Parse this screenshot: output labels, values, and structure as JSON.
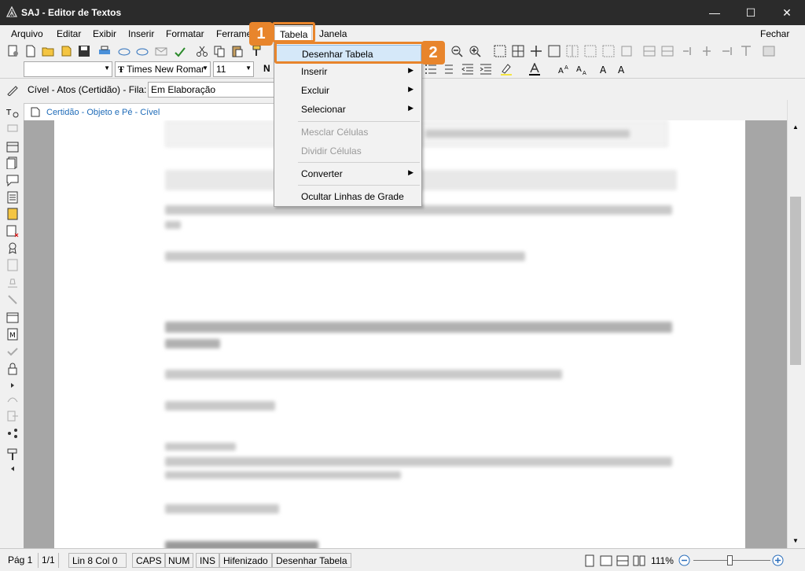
{
  "window": {
    "title": "SAJ - Editor de Textos",
    "minimize": "—",
    "maximize": "☐",
    "close": "✕"
  },
  "menubar": {
    "items": [
      {
        "label": "Arquivo"
      },
      {
        "label": "Editar"
      },
      {
        "label": "Exibir"
      },
      {
        "label": "Inserir"
      },
      {
        "label": "Formatar"
      },
      {
        "label": "Ferrame"
      },
      {
        "label": "Tabela"
      },
      {
        "label": "Janela"
      }
    ],
    "fechar": "Fechar"
  },
  "toolbar": {
    "font_name": "Times New Romar",
    "font_size": "11",
    "bold_label": "N"
  },
  "row3": {
    "label": "Cível - Atos (Certidão) - Fila:",
    "fila_value": "Em Elaboração"
  },
  "doc_tab": {
    "label": "Certidão - Objeto e Pé - Cível"
  },
  "tabela_menu": {
    "items": [
      {
        "label": "Desenhar Tabela",
        "submenu": false,
        "enabled": true
      },
      {
        "label": "Inserir",
        "submenu": true,
        "enabled": true
      },
      {
        "label": "Excluir",
        "submenu": true,
        "enabled": true
      },
      {
        "label": "Selecionar",
        "submenu": true,
        "enabled": true
      },
      {
        "label": "Mesclar Células",
        "submenu": false,
        "enabled": false
      },
      {
        "label": "Dividir Células",
        "submenu": false,
        "enabled": false
      },
      {
        "label": "Converter",
        "submenu": true,
        "enabled": true
      },
      {
        "label": "Ocultar Linhas de Grade",
        "submenu": false,
        "enabled": true
      }
    ]
  },
  "callouts": {
    "one": "1",
    "two": "2"
  },
  "statusbar": {
    "page": "Pág 1",
    "page_of": "1/1",
    "position": "Lin 8  Col 0",
    "caps": "CAPS",
    "num": "NUM",
    "ins": "INS",
    "hifenizado": "Hifenizado",
    "action": "Desenhar Tabela",
    "zoom": "111%"
  },
  "colors": {
    "accent_callout": "#e8852c",
    "title_bar": "#2b2b2b",
    "doc_tab_text": "#1e6bb8"
  }
}
